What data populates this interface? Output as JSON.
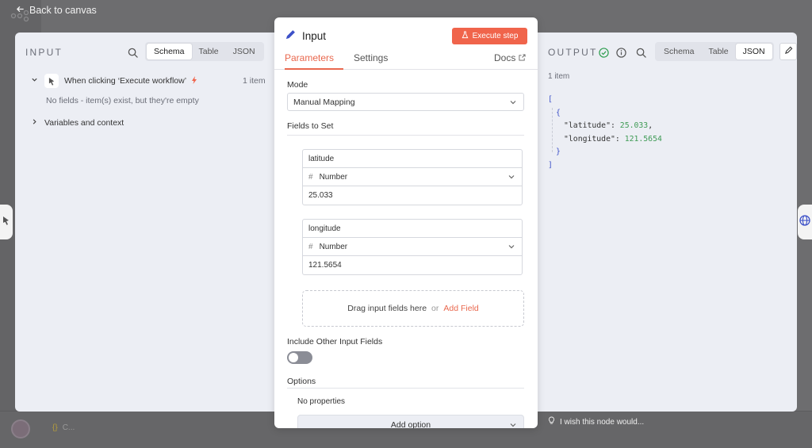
{
  "canvas": {
    "back_label": "Back to canvas",
    "bottom_node_label": "C..."
  },
  "input": {
    "title": "INPUT",
    "view_tabs": [
      "Schema",
      "Table",
      "JSON"
    ],
    "active_view": "Schema",
    "trigger_label": "When clicking ‘Execute workflow’",
    "trigger_count": "1 item",
    "empty_message": "No fields - item(s) exist, but they're empty",
    "variables_label": "Variables and context"
  },
  "node": {
    "title": "Input",
    "execute_label": "Execute step",
    "tabs": [
      "Parameters",
      "Settings"
    ],
    "active_tab": "Parameters",
    "docs_label": "Docs",
    "mode_label": "Mode",
    "mode_value": "Manual Mapping",
    "fields_label": "Fields to Set",
    "fields": [
      {
        "name": "latitude",
        "type": "Number",
        "value": "25.033"
      },
      {
        "name": "longitude",
        "type": "Number",
        "value": "121.5654"
      }
    ],
    "dropzone_text": "Drag input fields here",
    "dropzone_or": "or",
    "add_field_label": "Add Field",
    "include_label": "Include Other Input Fields",
    "include_enabled": false,
    "options_label": "Options",
    "no_properties": "No properties",
    "add_option_label": "Add option"
  },
  "output": {
    "title": "OUTPUT",
    "view_tabs": [
      "Schema",
      "Table",
      "JSON"
    ],
    "active_view": "JSON",
    "count": "1 item",
    "json_lines": {
      "open_bracket": "[",
      "open_brace": "{",
      "lat_key": "\"latitude\":",
      "lat_val": "25.033",
      "lon_key": "\"longitude\":",
      "lon_val": "121.5654",
      "close_brace": "}",
      "close_bracket": "]"
    },
    "feedback": "I wish this node would..."
  },
  "colors": {
    "accent": "#f0644b",
    "json_bracket": "#3d51c8",
    "json_number": "#3f9b55",
    "success": "#2e9e4f"
  }
}
